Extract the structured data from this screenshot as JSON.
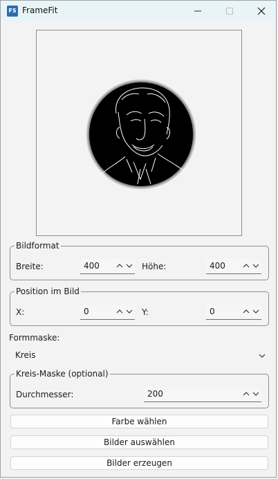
{
  "window": {
    "title": "FrameFit",
    "icon_text": "FS",
    "minimize_icon": "minimize-icon",
    "maximize_icon": "maximize-icon",
    "close_icon": "close-icon"
  },
  "bildformat": {
    "title": "Bildformat",
    "breite_label": "Breite:",
    "breite_value": "400",
    "hoehe_label": "Höhe:",
    "hoehe_value": "400"
  },
  "position": {
    "title": "Position im Bild",
    "x_label": "X:",
    "x_value": "0",
    "y_label": "Y:",
    "y_value": "0"
  },
  "formmaske": {
    "label": "Formmaske:",
    "selected": "Kreis"
  },
  "kreis": {
    "title": "Kreis-Maske (optional)",
    "durchmesser_label": "Durchmesser:",
    "durchmesser_value": "200"
  },
  "buttons": {
    "farbe": "Farbe wählen",
    "auswaehlen": "Bilder auswählen",
    "erzeugen": "Bilder erzeugen"
  },
  "colors": {
    "titlebar": "#e9f4f6",
    "accent": "#2a6db6",
    "preview_disc": "#000000"
  }
}
